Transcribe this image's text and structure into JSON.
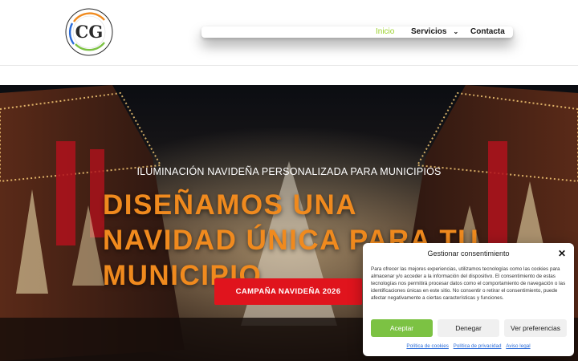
{
  "brand": {
    "logo_initials": "CG",
    "logo_ring_text": "EFICIENCIA ENERGÉTICA DEL AGUA"
  },
  "nav": {
    "items": [
      {
        "label": "Inicio",
        "active": true
      },
      {
        "label": "Servicios",
        "has_dropdown": true,
        "icon": "chevron-down-icon"
      },
      {
        "label": "Contacta"
      }
    ]
  },
  "hero": {
    "subtitle": "ILUMINACIÓN NAVIDEÑA PERSONALIZADA PARA MUNICIPIOS",
    "title": "DISEÑAMOS UNA NAVIDAD ÚNICA PARA TU MUNICIPIO",
    "cta_label": "CAMPAÑA NAVIDEÑA 2026"
  },
  "consent": {
    "title": "Gestionar consentimiento",
    "close_icon": "close-icon",
    "body": "Para ofrecer las mejores experiencias, utilizamos tecnologías como las cookies para almacenar y/o acceder a la información del dispositivo. El consentimiento de estas tecnologías nos permitirá procesar datos como el comportamiento de navegación o las identificaciones únicas en este sitio. No consentir o retirar el consentimiento, puede afectar negativamente a ciertas características y funciones.",
    "accept_label": "Aceptar",
    "deny_label": "Denegar",
    "prefs_label": "Ver preferencias",
    "links": [
      "Política de cookies",
      "Política de privacidad",
      "Aviso legal"
    ]
  },
  "colors": {
    "accent_green": "#9bd12c",
    "title_orange": "#f08a1e",
    "cta_red": "#e0141d",
    "accept_green": "#7cc243",
    "link_blue": "#2a6bd8"
  }
}
